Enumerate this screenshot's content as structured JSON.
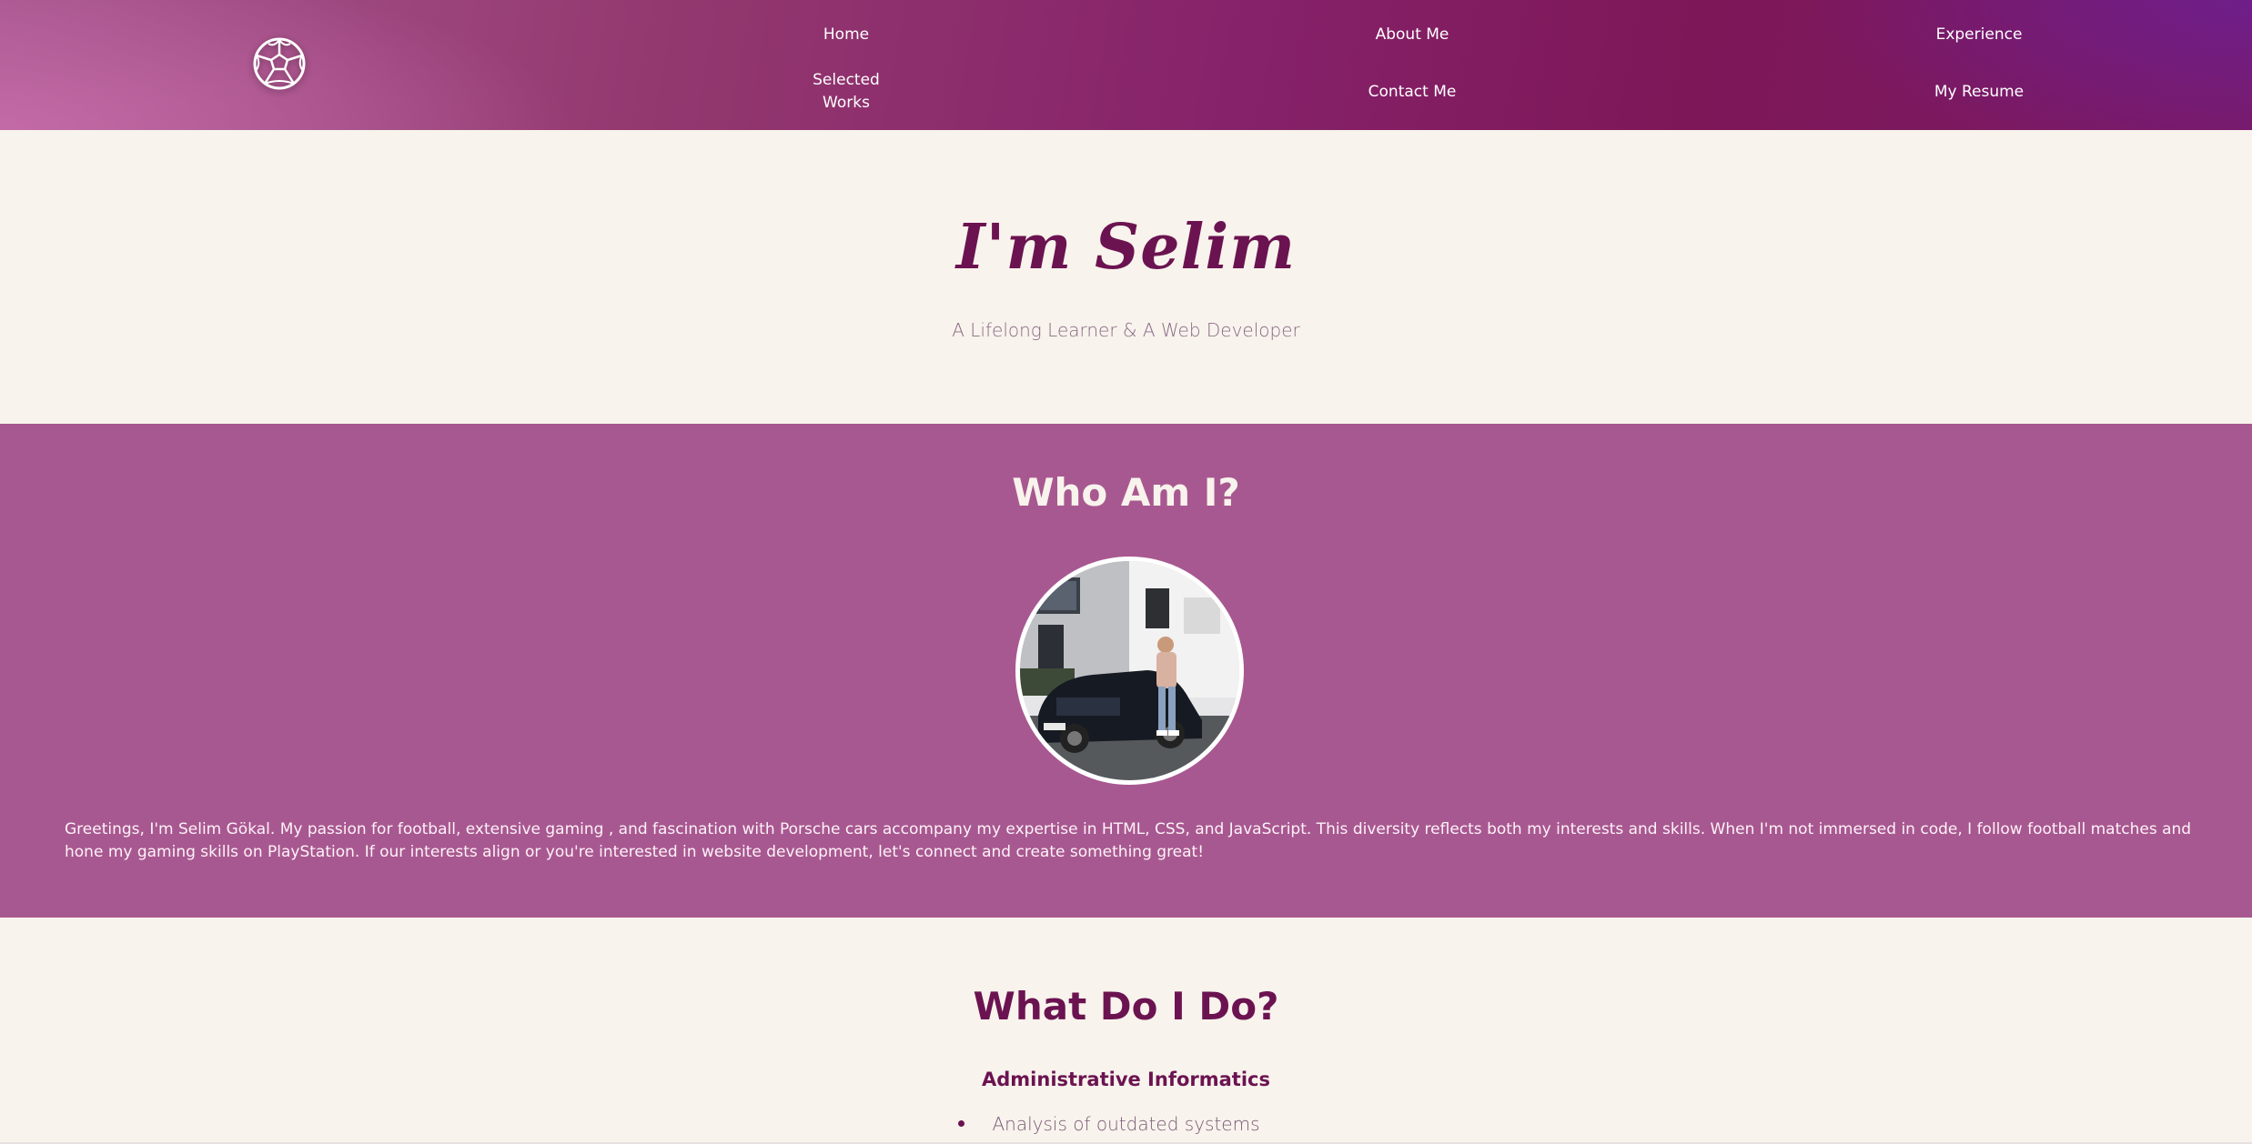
{
  "header": {
    "logo_icon": "soccer-ball-icon",
    "nav": {
      "home": "Home",
      "about": "About Me",
      "experience": "Experience",
      "selected_works_line1": "Selected",
      "selected_works_line2": "Works",
      "contact": "Contact Me",
      "resume": "My Resume"
    }
  },
  "hero": {
    "title": "I'm Selim",
    "subtitle": "A Lifelong Learner & A Web Developer"
  },
  "about": {
    "title": "Who Am I?",
    "text": "Greetings, I'm Selim Gökal. My passion for football, extensive gaming , and fascination with Porsche cars accompany my expertise in HTML, CSS, and JavaScript. This diversity reflects both my interests and skills. When I'm not immersed in code, I follow football matches and hone my gaming skills on PlayStation. If our interests align or you're interested in website development, let's connect and create something great!"
  },
  "services": {
    "title": "What Do I Do?",
    "heading": "Administrative Informatics",
    "items": [
      "Analysis of outdated systems"
    ]
  },
  "colors": {
    "brand_dark": "#6b1351",
    "section_pink": "#a85890",
    "cream": "#f8f3ec"
  }
}
